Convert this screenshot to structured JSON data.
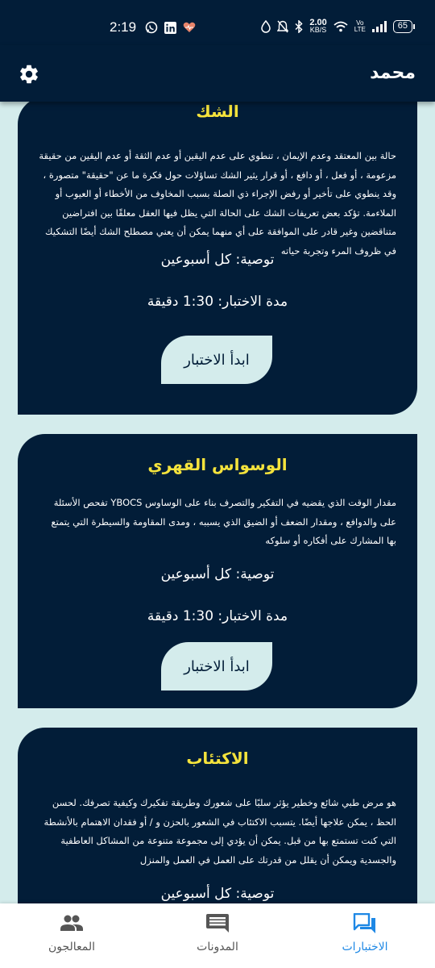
{
  "status_bar": {
    "time": "2:19",
    "network_speed_value": "2.00",
    "network_speed_unit": "KB/S",
    "volte": "Vo LTE",
    "battery": "65"
  },
  "app_bar": {
    "title": "محمد"
  },
  "tests": [
    {
      "title": "الشك",
      "description": "حالة بين المعتقد وعدم الإيمان ، تنطوي على عدم اليقين أو عدم الثقة أو عدم اليقين من حقيقة مزعومة ، أو فعل ، أو دافع ، أو قرار يثير الشك تساؤلات حول فكرة ما عن \"حقيقة\" متصورة ، وقد ينطوي على تأخير أو رفض الإجراء ذي الصلة بسبب المخاوف من الأخطاء أو العيوب أو الملاءمة. تؤكد بعض تعريفات الشك على الحالة التي يظل فيها العقل معلقًا بين افتراضين متناقضين وغير قادر على الموافقة على أي منهما  يمكن أن يعني مصطلح الشك أيضًا التشكيك في ظروف المرء وتجربة حياته",
      "recommendation": "توصية: كل أسبوعين",
      "duration": "مدة الاختبار: 1:30 دقيقة",
      "button": "ابدأ الاختبار"
    },
    {
      "title": "الوسواس القهري",
      "description": "مقدار الوقت الذي يقضيه في التفكير والتصرف بناء على الوساوس YBOCS تفحص الأسئلة على والدوافع ، ومقدار الضعف أو الضيق الذي يسببه ، ومدى المقاومة والسيطرة التي يتمتع بها المشارك على أفكاره أو سلوكه",
      "recommendation": "توصية: كل أسبوعين",
      "duration": "مدة الاختبار: 1:30 دقيقة",
      "button": "ابدأ الاختبار"
    },
    {
      "title": "الاكتئاب",
      "description": "هو مرض طبي شائع وخطير يؤثر سلبًا على شعورك وطريقة تفكيرك وكيفية تصرفك. لحسن الحظ ، يمكن علاجها أيضًا. يتسبب الاكتئاب في الشعور بالحزن و / أو فقدان الاهتمام بالأنشطة التي كنت تستمتع بها من قبل. يمكن أن يؤدي إلى مجموعة متنوعة من المشاكل العاطفية والجسدية ويمكن أن يقلل من قدرتك على العمل في العمل والمنزل",
      "recommendation": "توصية: كل أسبوعين"
    }
  ],
  "bottom_nav": {
    "items": [
      {
        "label": "المعالجون",
        "icon": "people-icon",
        "active": false
      },
      {
        "label": "المدونات",
        "icon": "comment-icon",
        "active": false
      },
      {
        "label": "الاختبارات",
        "icon": "forum-icon",
        "active": true
      }
    ]
  },
  "colors": {
    "primary": "#021d38",
    "background": "#d4ecec",
    "title_yellow": "#f5e33c",
    "nav_active": "#1e88e5"
  }
}
